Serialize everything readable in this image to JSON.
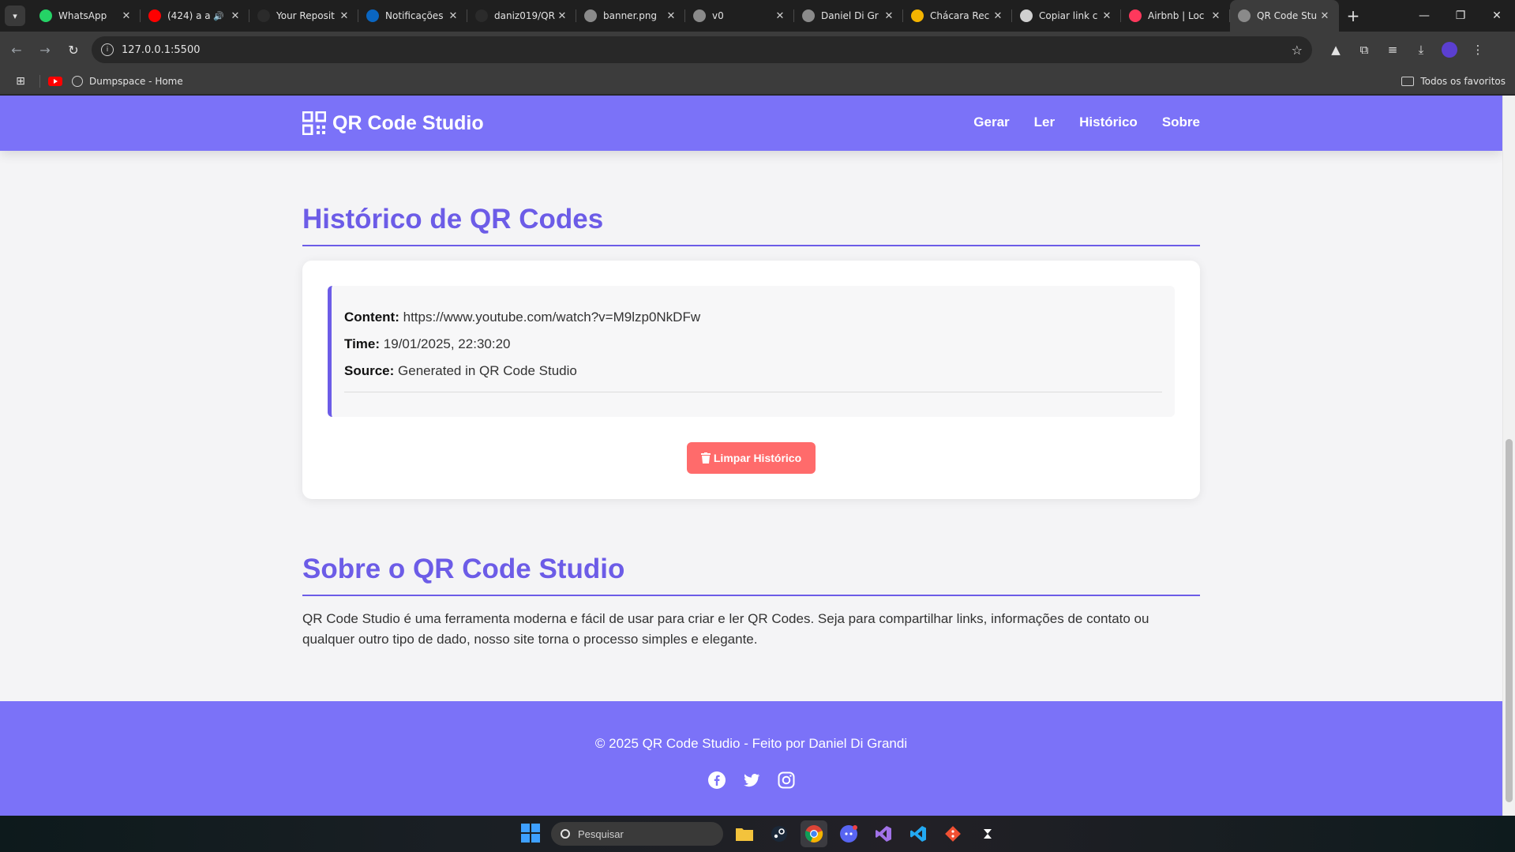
{
  "browser": {
    "tabs": [
      {
        "label": "WhatsApp",
        "fav_color": "#25d366",
        "icon": "whatsapp-icon",
        "active": false
      },
      {
        "label": "(424) a a",
        "fav_color": "#ff0000",
        "icon": "youtube-icon",
        "active": false,
        "sound": true
      },
      {
        "label": "Your Reposit",
        "fav_color": "#2b2b2b",
        "icon": "github-icon",
        "active": false
      },
      {
        "label": "Notificações",
        "fav_color": "#0a66c2",
        "icon": "linkedin-icon",
        "active": false
      },
      {
        "label": "daniz019/QR",
        "fav_color": "#2b2b2b",
        "icon": "github-icon",
        "active": false
      },
      {
        "label": "banner.png",
        "fav_color": "#8a8a8a",
        "icon": "globe-icon",
        "active": false
      },
      {
        "label": "v0",
        "fav_color": "#8a8a8a",
        "icon": "globe-icon",
        "active": false
      },
      {
        "label": "Daniel Di Gr",
        "fav_color": "#8a8a8a",
        "icon": "globe-icon",
        "active": false
      },
      {
        "label": "Chácara Rec",
        "fav_color": "#f4b400",
        "icon": "sun-icon",
        "active": false
      },
      {
        "label": "Copiar link c",
        "fav_color": "#d0d0d0",
        "icon": "openai-icon",
        "active": false
      },
      {
        "label": "Airbnb | Loc",
        "fav_color": "#ff385c",
        "icon": "airbnb-icon",
        "active": false
      },
      {
        "label": "QR Code Stu",
        "fav_color": "#8a8a8a",
        "icon": "globe-icon",
        "active": true
      }
    ],
    "url": "127.0.0.1:5500",
    "bookmarks": [
      {
        "label": "",
        "icon": "youtube-icon"
      },
      {
        "label": "Dumpspace - Home",
        "icon": "globe-icon"
      }
    ],
    "all_bookmarks_label": "Todos os favoritos"
  },
  "site": {
    "brand": "QR Code Studio",
    "nav": [
      "Gerar",
      "Ler",
      "Histórico",
      "Sobre"
    ],
    "history_title": "Histórico de QR Codes",
    "history_item": {
      "content_label": "Content:",
      "content_value": "https://www.youtube.com/watch?v=M9lzp0NkDFw",
      "time_label": "Time:",
      "time_value": "19/01/2025, 22:30:20",
      "source_label": "Source:",
      "source_value": "Generated in QR Code Studio"
    },
    "clear_button": "Limpar Histórico",
    "about_title": "Sobre o QR Code Studio",
    "about_text": "QR Code Studio é uma ferramenta moderna e fácil de usar para criar e ler QR Codes. Seja para compartilhar links, informações de contato ou qualquer outro tipo de dado, nosso site torna o processo simples e elegante.",
    "footer_text": "© 2025 QR Code Studio - Feito por Daniel Di Grandi",
    "colors": {
      "primary": "#7b72f8",
      "title": "#6c5ce7",
      "danger": "#ff6b6b"
    }
  },
  "taskbar": {
    "search_placeholder": "Pesquisar"
  }
}
